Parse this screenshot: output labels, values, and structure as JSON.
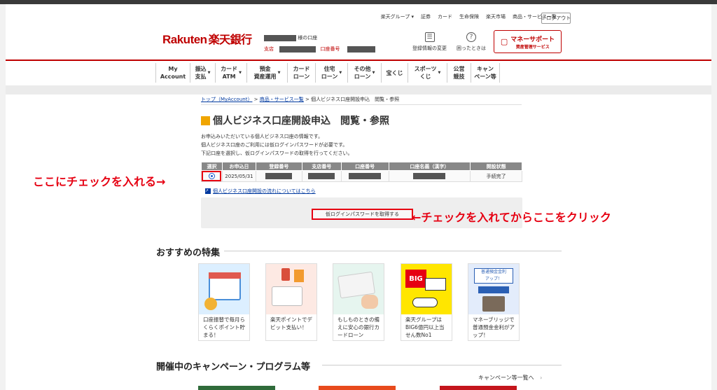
{
  "utility_links": [
    "楽天グループ ▾",
    "証券",
    "カード",
    "生命保険",
    "楽天市場",
    "商品・サービス一覧"
  ],
  "logout_label": "ログアウト",
  "logo": {
    "en": "Rakuten",
    "jp": "楽天銀行"
  },
  "account": {
    "name_suffix": "様の口座",
    "branch_label": "支店",
    "number_label": "口座番号"
  },
  "header_icons": [
    {
      "icon": "user-edit-icon",
      "label": "登録情報の変更"
    },
    {
      "icon": "help-icon",
      "label": "困ったときは"
    }
  ],
  "money_support": {
    "title": "マネーサポート",
    "subtitle": "資産管理サービス"
  },
  "nav": [
    {
      "l1": "My",
      "l2": "Account",
      "caret": false
    },
    {
      "l1": "振込",
      "l2": "支払",
      "caret": true
    },
    {
      "l1": "カード",
      "l2": "ATM",
      "caret": true
    },
    {
      "l1": "預金",
      "l2": "資産運用",
      "caret": true
    },
    {
      "l1": "カード",
      "l2": "ローン",
      "caret": false
    },
    {
      "l1": "住宅",
      "l2": "ローン",
      "caret": true
    },
    {
      "l1": "その他",
      "l2": "ローン",
      "caret": true
    },
    {
      "l1": "宝くじ",
      "l2": "",
      "caret": false
    },
    {
      "l1": "スポーツ",
      "l2": "くじ",
      "caret": true
    },
    {
      "l1": "公営",
      "l2": "競技",
      "caret": false
    },
    {
      "l1": "キャン",
      "l2": "ペーン等",
      "caret": false
    }
  ],
  "breadcrumb": {
    "top": "トップ（MyAccount）",
    "sep": " > ",
    "list": "商品・サービス一覧",
    "current": "個人ビジネス口座開設申込　閲覧・参照"
  },
  "page_title": "個人ビジネス口座開設申込　閲覧・参照",
  "description": [
    "お申込みいただいている個人ビジネス口座の情報です。",
    "個人ビジネス口座のご利用には仮ログインパスワードが必要です。",
    "下記口座を選択し、仮ログインパスワードの取得を行ってください。"
  ],
  "table": {
    "headers": [
      "選択",
      "お申込日",
      "登録番号",
      "支店番号",
      "口座番号",
      "口座名義（漢字）",
      "開設状態"
    ],
    "row": {
      "date": "2025/05/31",
      "status": "手続完了"
    }
  },
  "flow_link": "個人ビジネス口座開設の流れについてはこちら",
  "get_password_button": "仮ログインパスワードを取得する",
  "annotations": {
    "check": "ここにチェックを入れる→",
    "click": "←チェックを入れてからここをクリック"
  },
  "features_title": "おすすめの特集",
  "features": [
    {
      "text": "口座振替で毎月らくらくポイント貯まる！",
      "bg": "#dcefff"
    },
    {
      "text": "楽天ポイントでデビット支払い！",
      "bg": "#fde9e3"
    },
    {
      "text": "もしものときの備えに安心の銀行カードローン",
      "bg": "#e6f5ef"
    },
    {
      "text": "楽天グループはBIG6億円以上当せん数No1",
      "bg": "#ffe600"
    },
    {
      "text": "マネーブリッジで普通預金金利がアップ！",
      "bg": "#e3ecfb"
    }
  ],
  "campaign_title": "開催中のキャンペーン・プログラム等",
  "campaign_more": "キャンペーン等一覧へ",
  "colors": {
    "brand_red": "#bf0000",
    "highlight_red": "#e60012",
    "link_blue": "#00399f"
  }
}
